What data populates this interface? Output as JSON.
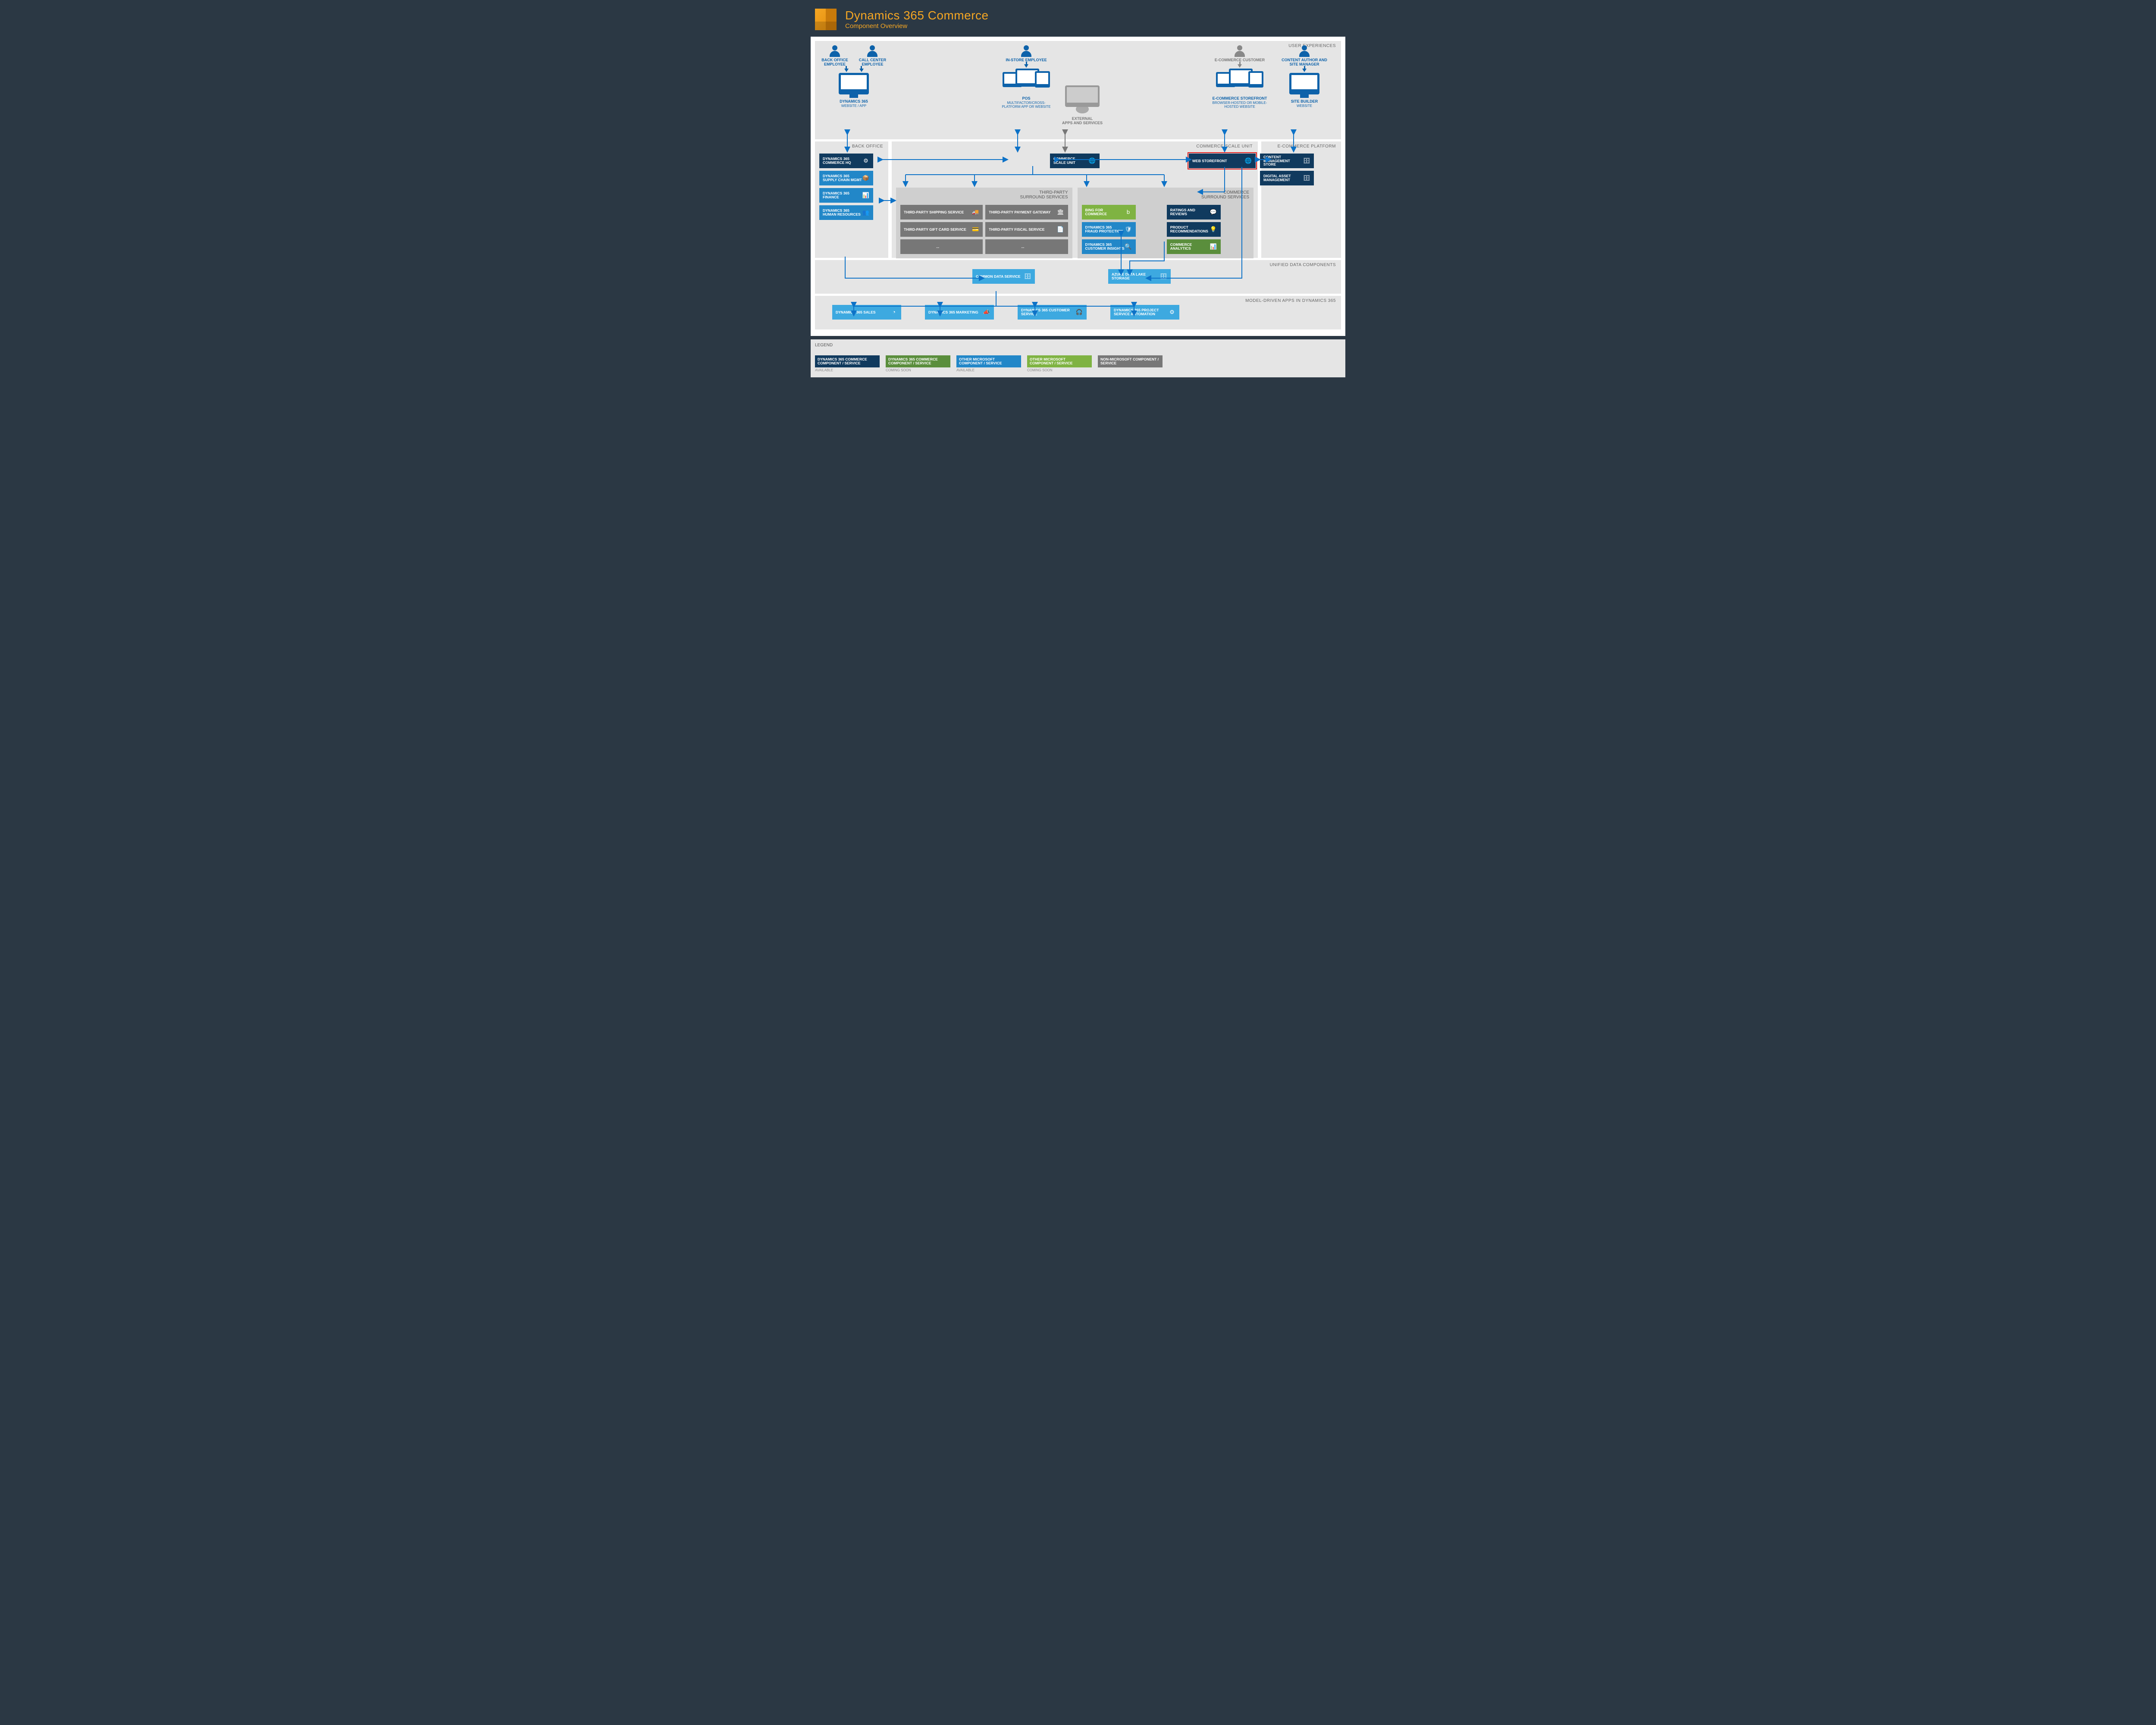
{
  "header": {
    "title": "Dynamics 365 Commerce",
    "subtitle": "Component Overview"
  },
  "sections": {
    "ux": "USER EXPERIENCES",
    "backoffice": "BACK OFFICE",
    "csu": "COMMERCE SCALE UNIT",
    "ecp": "E-COMMERCE PLATFORM",
    "tp": "THIRD-PARTY\nSURROUND SERVICES",
    "css": "COMMERCE\nSURROUND SERVICES",
    "udc": "UNIFIED DATA COMPONENTS",
    "mda": "MODEL-DRIVEN APPS IN DYNAMICS 365"
  },
  "personas": {
    "backoffice": "BACK OFFICE EMPLOYEE",
    "callcenter": "CALL CENTER EMPLOYEE",
    "instore": "IN-STORE EMPLOYEE",
    "external": "EXTERNAL\nAPPS AND SERVICES",
    "ecustomer": "E-COMMERCE CUSTOMER",
    "author": "CONTENT AUTHOR AND SITE MANAGER"
  },
  "devices": {
    "d365": {
      "title": "DYNAMICS 365",
      "sub": "WEBSITE / APP"
    },
    "pos": {
      "title": "POS",
      "sub": "MULTIFACTOR/CROSS-PLATFORM APP OR WEBSITE"
    },
    "storefront": {
      "title": "E-COMMERCE STOREFRONT",
      "sub": "BROWSER-HOSTED OR MOBILE-HOSTED WEBSITE"
    },
    "sitebuilder": {
      "title": "SITE BUILDER",
      "sub": "WEBSITE"
    }
  },
  "backoffice": [
    {
      "name": "DYNAMICS 365 COMMERCE HQ",
      "cls": "c-dblue",
      "icon": "⚙"
    },
    {
      "name": "DYNAMICS 365 SUPPLY CHAIN MGMT",
      "cls": "c-mblue",
      "icon": "📦"
    },
    {
      "name": "DYNAMICS 365 FINANCE",
      "cls": "c-mblue",
      "icon": "📊"
    },
    {
      "name": "DYNAMICS 365 HUMAN RESOURCES",
      "cls": "c-mblue",
      "icon": "👥"
    }
  ],
  "csu": {
    "name": "COMMERCE SCALE UNIT",
    "icon": "🌐"
  },
  "web_storefront": {
    "name": "WEB STOREFRONT",
    "icon": "🌐"
  },
  "ecp": [
    {
      "name": "CONTENT MANAGEMENT STORE",
      "cls": "c-dblue",
      "icon": "🗄"
    },
    {
      "name": "DIGITAL ASSET MANAGEMENT",
      "cls": "c-dblue",
      "icon": "🗄"
    }
  ],
  "thirdparty": [
    {
      "name": "THIRD-PARTY SHIPPING SERVICE",
      "icon": "🚚"
    },
    {
      "name": "THIRD-PARTY PAYMENT GATEWAY",
      "icon": "🏛"
    },
    {
      "name": "THIRD-PARTY GIFT CARD SERVICE",
      "icon": "💳"
    },
    {
      "name": "THIRD-PARTY FISCAL SERVICE",
      "icon": "📄"
    },
    {
      "name": "...",
      "icon": ""
    },
    {
      "name": "...",
      "icon": ""
    }
  ],
  "commerce_ss": {
    "left": [
      {
        "name": "BING FOR COMMERCE",
        "cls": "c-green",
        "icon": "b"
      },
      {
        "name": "DYNAMICS 365 FRAUD PROTECTION",
        "cls": "c-mblue",
        "icon": "🛡"
      },
      {
        "name": "DYNAMICS 365 CUSTOMER INSIGHTS",
        "cls": "c-mblue",
        "icon": "🔍"
      }
    ],
    "right": [
      {
        "name": "RATINGS AND REVIEWS",
        "cls": "c-dblue",
        "icon": "💬"
      },
      {
        "name": "PRODUCT RECOMMENDATIONS",
        "cls": "c-dblue",
        "icon": "💡"
      },
      {
        "name": "COMMERCE ANALYTICS",
        "cls": "c-dgreen",
        "icon": "📊"
      }
    ]
  },
  "udc": [
    {
      "name": "COMMON DATA SERVICE",
      "icon": "🗄"
    },
    {
      "name": "AZURE DATA LAKE STORAGE",
      "icon": "🗄"
    }
  ],
  "mda": [
    {
      "name": "DYNAMICS 365 SALES",
      "icon": "◔"
    },
    {
      "name": "DYNAMICS 365 MARKETING",
      "icon": "📣"
    },
    {
      "name": "DYNAMICS 365 CUSTOMER SERVICE",
      "icon": "🎧"
    },
    {
      "name": "DYNAMICS 365 PROJECT SERVICE AUTOMATION",
      "icon": "⚙"
    }
  ],
  "legend": {
    "title": "LEGEND",
    "items": [
      {
        "label": "DYNAMICS 365 COMMERCE COMPONENT / SERVICE",
        "status": "AVAILABLE",
        "cls": "c-dblue"
      },
      {
        "label": "DYNAMICS 365 COMMERCE COMPONENT / SERVICE",
        "status": "COMING SOON",
        "cls": "c-dgreen"
      },
      {
        "label": "OTHER MICROSOFT COMPONENT / SERVICE",
        "status": "AVAILABLE",
        "cls": "c-mblue"
      },
      {
        "label": "OTHER MICROSOFT COMPONENT / SERVICE",
        "status": "COMING SOON",
        "cls": "c-green"
      },
      {
        "label": "NON-MICROSOFT COMPONENT / SERVICE",
        "status": "",
        "cls": "c-grey"
      }
    ]
  }
}
